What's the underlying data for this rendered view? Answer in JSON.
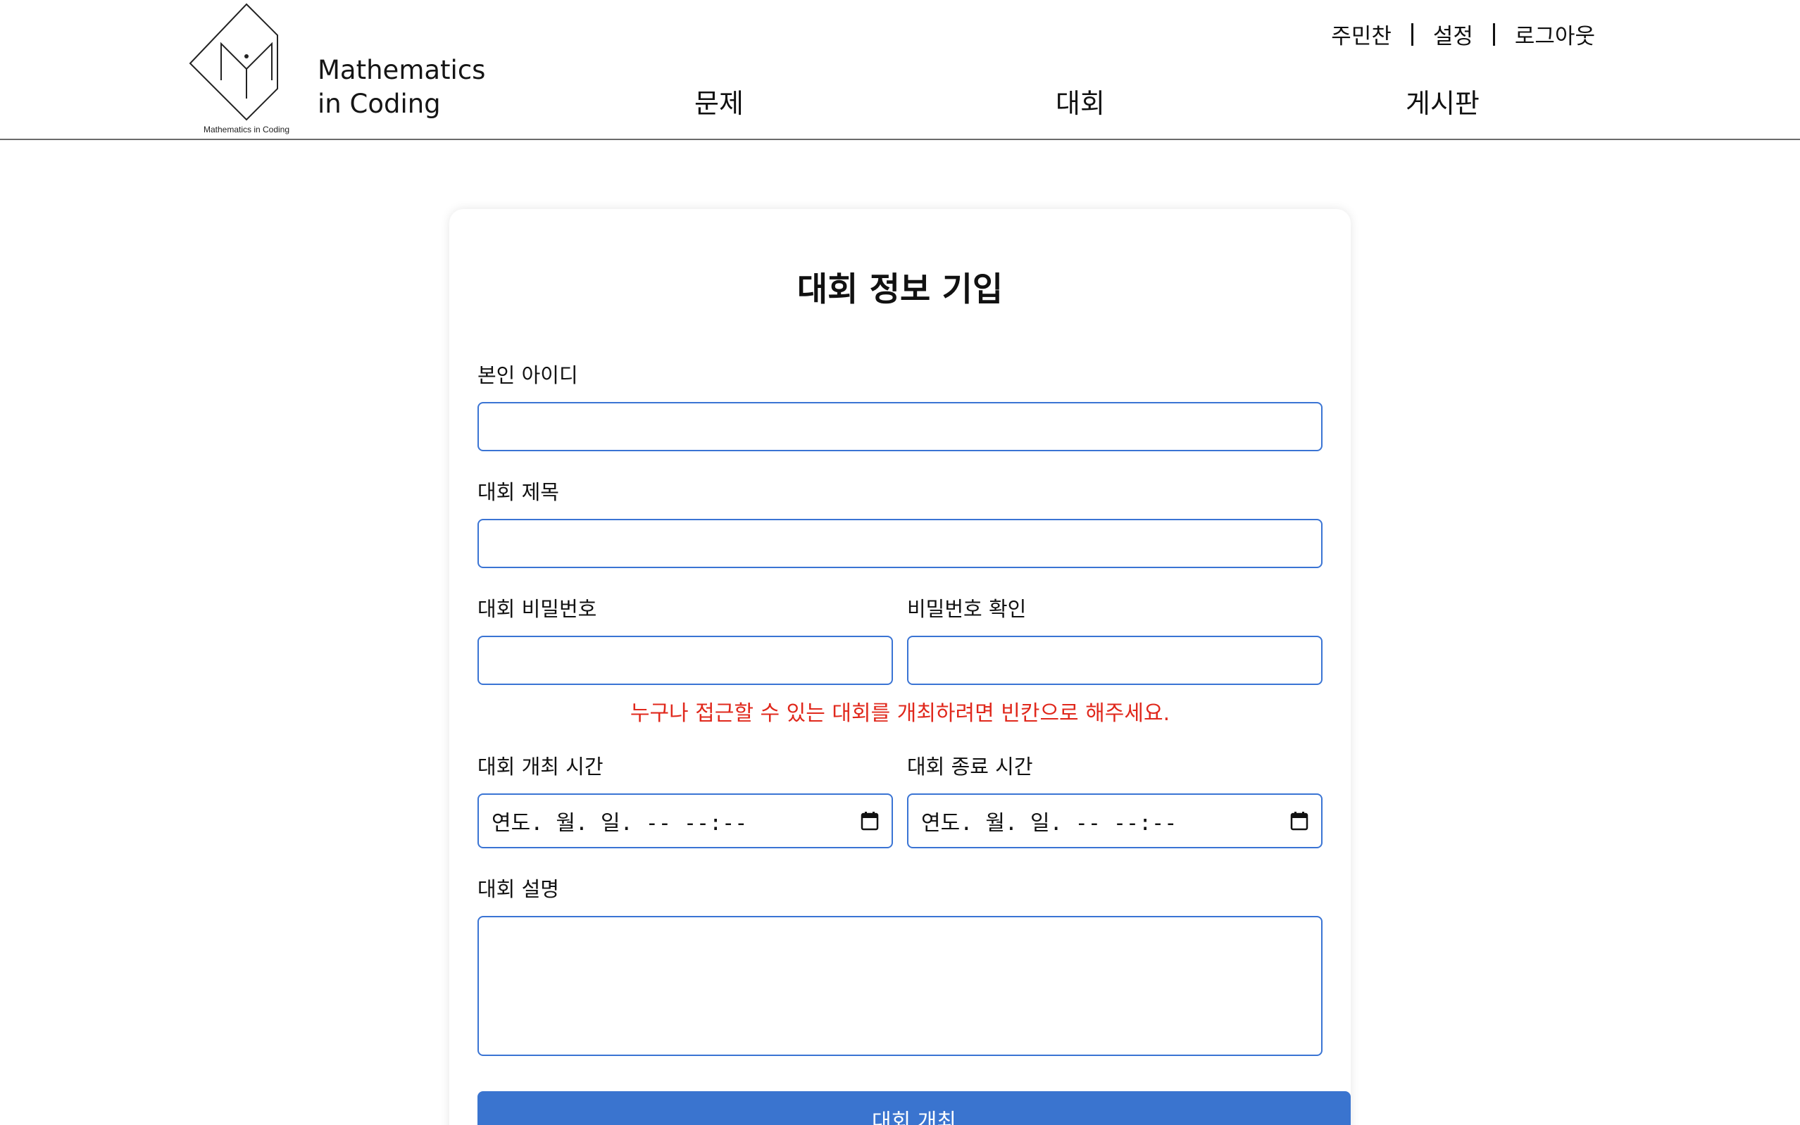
{
  "header": {
    "brand_line1": "Mathematics",
    "brand_line2": "in Coding",
    "logo_caption": "Mathematics in Coding",
    "user_nav": {
      "username": "주민찬",
      "settings": "설정",
      "logout": "로그아웃"
    },
    "main_nav": [
      "문제",
      "대회",
      "게시판"
    ]
  },
  "form": {
    "title": "대회 정보 기입",
    "user_id_label": "본인 아이디",
    "user_id_value": "",
    "contest_title_label": "대회 제목",
    "contest_title_value": "",
    "password_label": "대회 비밀번호",
    "password_value": "",
    "password_confirm_label": "비밀번호 확인",
    "password_confirm_value": "",
    "password_hint": "누구나 접근할 수 있는 대회를 개최하려면 빈칸으로 해주세요.",
    "start_time_label": "대회 개최 시간",
    "start_time_placeholder": "연도. 월. 일. -- --:--",
    "end_time_label": "대회 종료 시간",
    "end_time_placeholder": "연도. 월. 일. -- --:--",
    "description_label": "대회 설명",
    "description_value": "",
    "submit_label": "대회 개최"
  },
  "colors": {
    "accent": "#3a74cf",
    "input_border": "#3a74d4",
    "warning": "#e0281c"
  }
}
